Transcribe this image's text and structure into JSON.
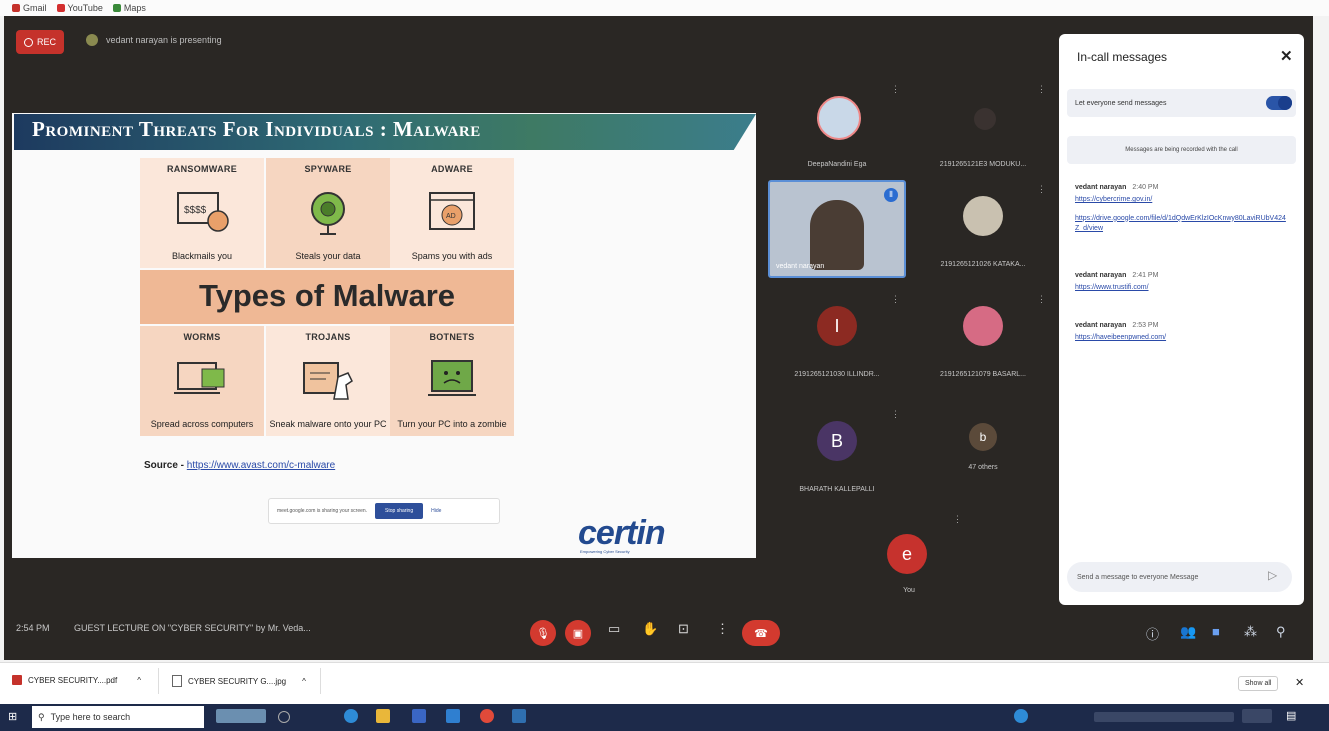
{
  "bookmarks": [
    {
      "label": "Gmail",
      "color": "#c5322b"
    },
    {
      "label": "YouTube",
      "color": "#d32f2f"
    },
    {
      "label": "Maps",
      "color": "#3a8a3a"
    }
  ],
  "meet": {
    "rec_label": "REC",
    "presenting_text": "vedant narayan is presenting",
    "time": "2:54 PM",
    "meeting_title": "GUEST LECTURE ON \"CYBER SECURITY\" by Mr. Veda..."
  },
  "slide": {
    "title": "Prominent Threats For Individuals : Malware",
    "types_title": "Types of Malware",
    "cards": [
      {
        "heading": "RANSOMWARE",
        "caption": "Blackmails you"
      },
      {
        "heading": "SPYWARE",
        "caption": "Steals your data"
      },
      {
        "heading": "ADWARE",
        "caption": "Spams you with ads"
      },
      {
        "heading": "WORMS",
        "caption": "Spread across computers"
      },
      {
        "heading": "TROJANS",
        "caption": "Sneak malware onto your PC"
      },
      {
        "heading": "BOTNETS",
        "caption": "Turn your PC into a zombie"
      }
    ],
    "source_label": "Source - ",
    "source_link": "https://www.avast.com/c-malware",
    "share_text": "meet.google.com is sharing your screen.",
    "stop_sharing": "Stop sharing",
    "hide": "Hide",
    "brand": "certin",
    "brand_tagline": "Empowering Cyber Security"
  },
  "participants": [
    {
      "name": "DeepaNandini Ega",
      "initial": "",
      "color": "#c9d8e8"
    },
    {
      "name": "2191265121E3 MODUKU...",
      "initial": "",
      "color": "#3a3230"
    },
    {
      "name": "vedant narayan",
      "initial": "",
      "color": "#b9c3d0"
    },
    {
      "name": "2191265121026 KATAKA...",
      "initial": "",
      "color": "#c9c1b0"
    },
    {
      "name": "2191265121030 ILLINDR...",
      "initial": "I",
      "color": "#8c2a22"
    },
    {
      "name": "2191265121079 BASARL...",
      "initial": "",
      "color": "#d66b84"
    },
    {
      "name": "BHARATH KALLEPALLI",
      "initial": "B",
      "color": "#4a3565"
    },
    {
      "name": "47 others",
      "initial": "b",
      "color": "#5b4a3a"
    },
    {
      "name": "You",
      "initial": "e",
      "color": "#c6322d"
    }
  ],
  "panel": {
    "title": "In-call messages",
    "allow_label": "Let everyone send messages",
    "recorded_note": "Messages are being recorded with the call",
    "messages": [
      {
        "sender": "vedant narayan",
        "time": "2:40 PM",
        "links": [
          "https://cybercrime.gov.in/",
          "https://drive.google.com/file/d/1dQdwErKlzIOcKnwy80LaviRUbV424Z_d/view"
        ]
      },
      {
        "sender": "vedant narayan",
        "time": "2:41 PM",
        "links": [
          "https://www.trustifi.com/"
        ]
      },
      {
        "sender": "vedant narayan",
        "time": "2:53 PM",
        "links": [
          "https://haveibeenpwned.com/"
        ]
      }
    ],
    "send_placeholder": "Send a message to everyone Message"
  },
  "downloads": {
    "items": [
      {
        "name": "CYBER SECURITY....pdf"
      },
      {
        "name": "CYBER SECURITY G....jpg"
      }
    ],
    "show_all": "Show all"
  },
  "taskbar": {
    "search_placeholder": "Type here to search"
  }
}
